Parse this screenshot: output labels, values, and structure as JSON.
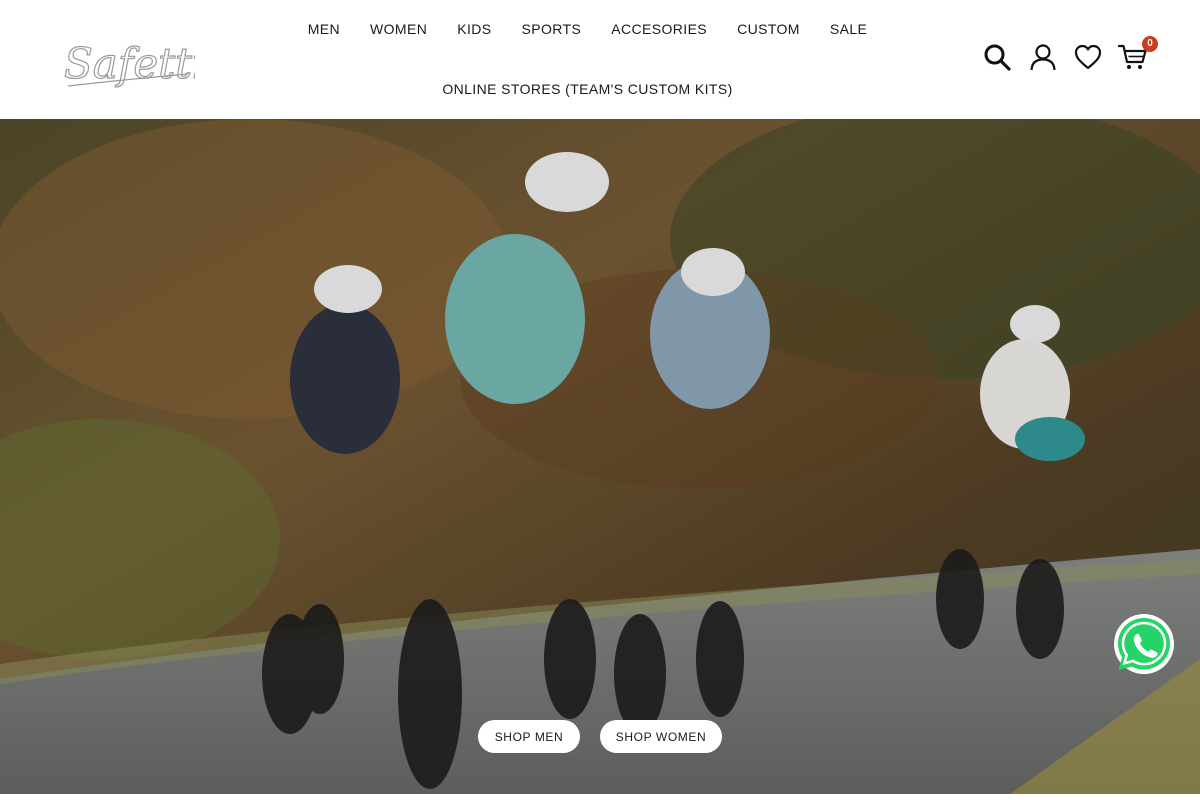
{
  "brand": {
    "logo_text": "Safetti",
    "colors": {
      "accent_badge": "#cc3a1f",
      "whatsapp": "#25d366",
      "header_bg": "#ffffff",
      "text": "#1a1a1a"
    }
  },
  "nav": {
    "items": [
      {
        "label": "MEN"
      },
      {
        "label": "WOMEN"
      },
      {
        "label": "KIDS"
      },
      {
        "label": "SPORTS"
      },
      {
        "label": "ACCESORIES"
      },
      {
        "label": "CUSTOM"
      },
      {
        "label": "SALE"
      }
    ],
    "secondary": {
      "label": "ONLINE STORES (TEAM'S CUSTOM KITS)"
    }
  },
  "header_icons": {
    "search": "search-icon",
    "account": "user-icon",
    "wishlist": "heart-icon",
    "cart": "cart-icon",
    "cart_count": "0"
  },
  "hero": {
    "image": "group of cyclists riding road bikes uphill on a mountain road",
    "buttons": {
      "shop_men": "SHOP MEN",
      "shop_women": "SHOP WOMEN"
    }
  },
  "floating": {
    "whatsapp": "whatsapp-icon"
  }
}
